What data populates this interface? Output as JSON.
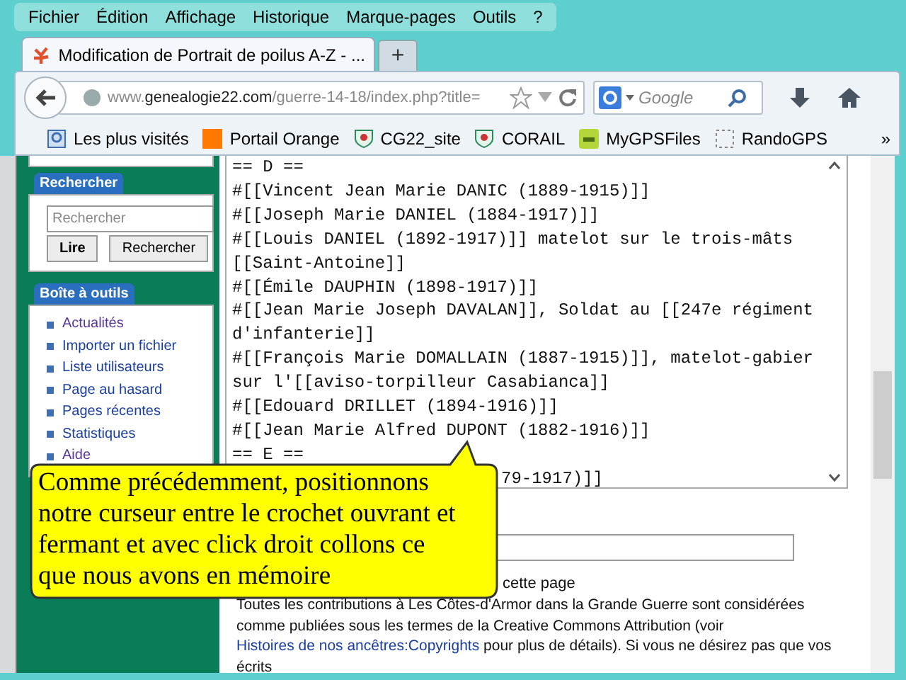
{
  "menu": [
    "Fichier",
    "Édition",
    "Affichage",
    "Historique",
    "Marque-pages",
    "Outils",
    "?"
  ],
  "tabs": [
    {
      "title": "Modification de Portrait de poilus A-Z - ...",
      "selected": true
    }
  ],
  "new_tab": "+",
  "address": {
    "prefix": "www.",
    "domain": "genealogie22.com",
    "path": "/guerre-14-18/index.php?title="
  },
  "search_engine": {
    "placeholder": "Google"
  },
  "bookmarks": [
    {
      "label": "Les plus visités",
      "kind": "search"
    },
    {
      "label": "Portail Orange",
      "kind": "orange"
    },
    {
      "label": "CG22_site",
      "kind": "crest"
    },
    {
      "label": "CORAIL",
      "kind": "crest"
    },
    {
      "label": "MyGPSFiles",
      "kind": "gps"
    },
    {
      "label": "RandoGPS",
      "kind": "blank"
    }
  ],
  "bookmarks_more": "»",
  "sidebar": {
    "search": {
      "title": "Rechercher",
      "placeholder": "Rechercher",
      "buttons": [
        "Lire",
        "Rechercher"
      ]
    },
    "toolbox": {
      "title": "Boîte à outils",
      "items": [
        {
          "label": "Actualités",
          "visited": true
        },
        {
          "label": "Importer un fichier",
          "visited": false
        },
        {
          "label": "Liste utilisateurs",
          "visited": false
        },
        {
          "label": "Page au hasard",
          "visited": false
        },
        {
          "label": "Pages récentes",
          "visited": false
        },
        {
          "label": "Statistiques",
          "visited": false
        },
        {
          "label": "Aide",
          "visited": true
        }
      ]
    }
  },
  "editor": {
    "lines": [
      "== D ==",
      "#[[Vincent Jean Marie DANIC (1889-1915)]]",
      "#[[Joseph Marie DANIEL (1884-1917)]]",
      "#[[Louis DANIEL (1892-1917)]] matelot sur le trois-mâts",
      "[[Saint-Antoine]]",
      "#[[Émile DAUPHIN (1898-1917)]]",
      "#[[Jean Marie Joseph DAVALAN]], Soldat au [[247e régiment",
      "d'infanterie]]",
      "#[[François Marie DOMALLAIN (1887-1915)]], matelot-gabier",
      "sur l'[[aviso-torpilleur Casabianca]]",
      "#[[Edouard DRILLET (1894-1916)]]",
      "#[[Jean Marie Alfred DUPONT (1882-1916)]]",
      "== E ==",
      "79-1917)]]"
    ]
  },
  "watch_text": "cette page",
  "license": {
    "before": "Toutes les contributions à Les Côtes-d'Armor dans la Grande Guerre sont considérées comme publiées sous les termes de la Creative Commons Attribution (voir",
    "link": "Histoires de nos ancêtres:Copyrights",
    "after": "pour plus de détails). Si vous ne désirez pas que vos écrits"
  },
  "callout": "Comme précédemment, positionnons notre curseur entre le crochet ouvrant et fermant et avec click droit collons ce que nous avons en mémoire"
}
